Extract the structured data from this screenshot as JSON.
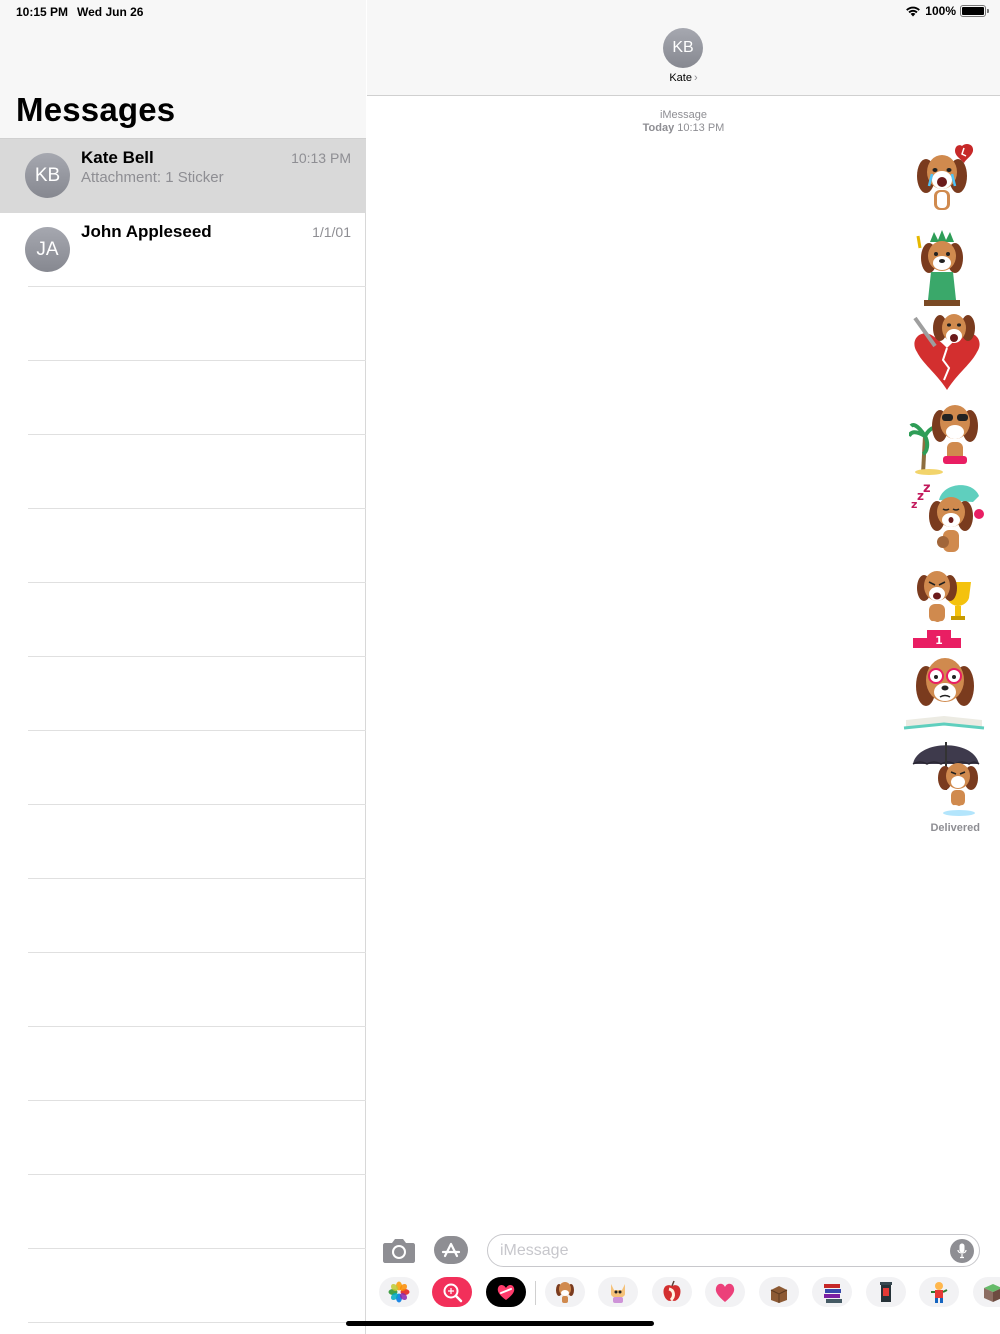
{
  "status_bar": {
    "time": "10:15 PM",
    "date": "Wed Jun 26",
    "battery": "100%",
    "battery_level": 1.0
  },
  "sidebar": {
    "title": "Messages",
    "conversations": [
      {
        "initials": "KB",
        "name": "Kate Bell",
        "time": "10:13 PM",
        "preview": "Attachment: 1 Sticker",
        "selected": true
      },
      {
        "initials": "JA",
        "name": "John Appleseed",
        "time": "1/1/01",
        "preview": "",
        "selected": false
      }
    ]
  },
  "conversation": {
    "contact_initials": "KB",
    "contact_name": "Kate",
    "service": "iMessage",
    "timestamp_day": "Today",
    "timestamp_time": "10:13 PM",
    "stickers": [
      "beagle-crying-heart-sticker",
      "beagle-statue-of-liberty-sticker",
      "beagle-broken-heart-sticker",
      "beagle-sunglasses-beach-sticker",
      "beagle-sleeping-nightcap-sticker",
      "beagle-trophy-podium-sticker",
      "beagle-glasses-book-sticker",
      "beagle-umbrella-rain-sticker"
    ],
    "delivered": "Delivered"
  },
  "compose": {
    "placeholder": "iMessage"
  },
  "app_drawer": [
    "photos-app-icon",
    "images-search-app-icon",
    "digital-touch-app-icon",
    "beagle-sticker-app-icon",
    "cat-sticker-app-icon",
    "apple-sticker-app-icon",
    "heart-sticker-app-icon",
    "chest-sticker-app-icon",
    "books-sticker-app-icon",
    "lantern-sticker-app-icon",
    "figure-sticker-app-icon",
    "block-sticker-app-icon"
  ]
}
